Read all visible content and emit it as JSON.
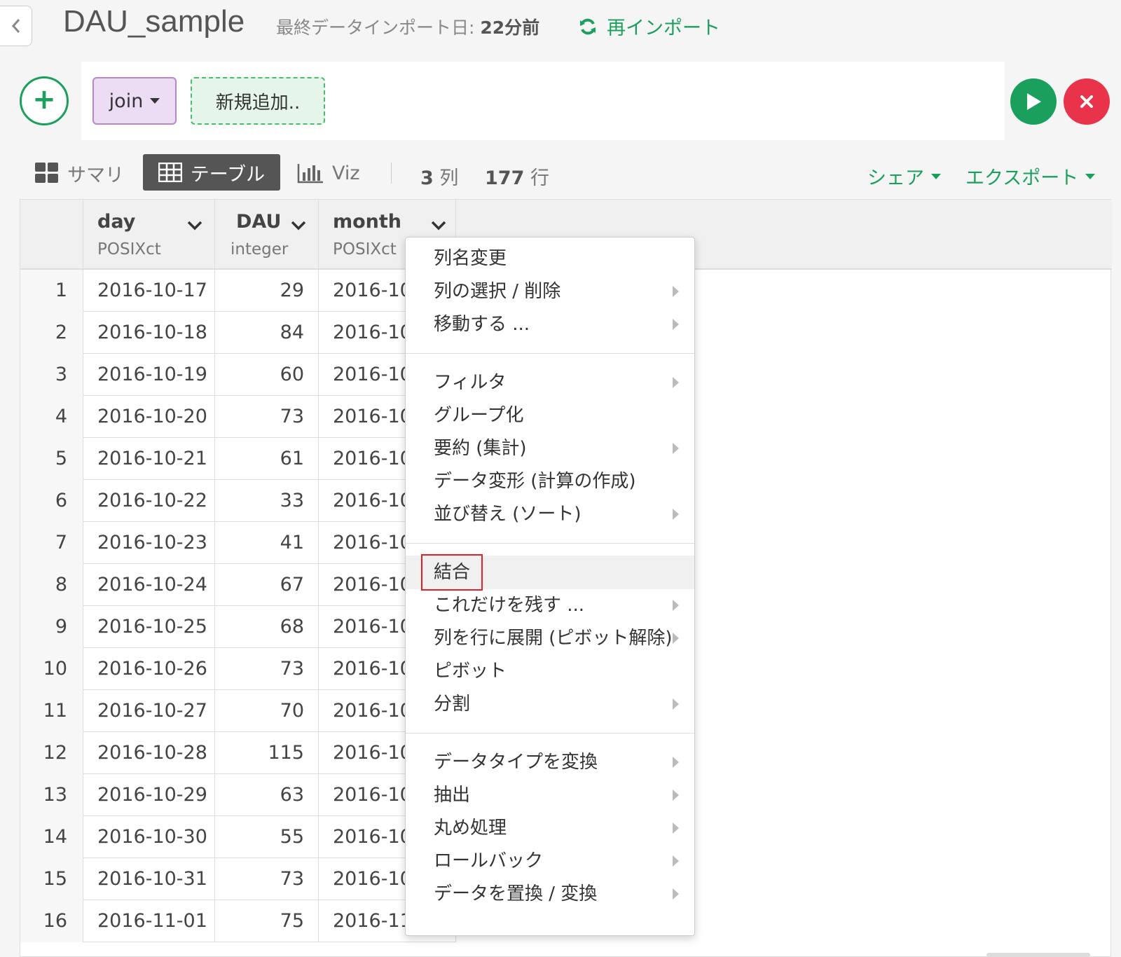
{
  "header": {
    "title": "DAU_sample",
    "last_import_label": "最終データインポート日: ",
    "last_import_value": "22分前",
    "reimport_label": "再インポート"
  },
  "pipeline": {
    "steps": [
      {
        "label": "join"
      }
    ],
    "new_step_label": "新規追加.."
  },
  "toolbar": {
    "tabs": [
      {
        "label": "サマリ",
        "icon": "grid-icon"
      },
      {
        "label": "テーブル",
        "icon": "table-icon",
        "active": true
      },
      {
        "label": "Viz",
        "icon": "bar-chart-icon"
      }
    ],
    "columns_count": "3",
    "columns_unit": " 列",
    "rows_count": "177",
    "rows_unit": " 行",
    "share_label": "シェア",
    "export_label": "エクスポート"
  },
  "table": {
    "columns": [
      {
        "name": "day",
        "type": "POSIXct"
      },
      {
        "name": "DAU",
        "type": "integer"
      },
      {
        "name": "month",
        "type": "POSIXct"
      }
    ],
    "rows": [
      {
        "num": "1",
        "day": "2016-10-17",
        "dau": "29",
        "month": "2016-10"
      },
      {
        "num": "2",
        "day": "2016-10-18",
        "dau": "84",
        "month": "2016-10"
      },
      {
        "num": "3",
        "day": "2016-10-19",
        "dau": "60",
        "month": "2016-10"
      },
      {
        "num": "4",
        "day": "2016-10-20",
        "dau": "73",
        "month": "2016-10"
      },
      {
        "num": "5",
        "day": "2016-10-21",
        "dau": "61",
        "month": "2016-10"
      },
      {
        "num": "6",
        "day": "2016-10-22",
        "dau": "33",
        "month": "2016-10"
      },
      {
        "num": "7",
        "day": "2016-10-23",
        "dau": "41",
        "month": "2016-10"
      },
      {
        "num": "8",
        "day": "2016-10-24",
        "dau": "67",
        "month": "2016-10"
      },
      {
        "num": "9",
        "day": "2016-10-25",
        "dau": "68",
        "month": "2016-10"
      },
      {
        "num": "10",
        "day": "2016-10-26",
        "dau": "73",
        "month": "2016-10"
      },
      {
        "num": "11",
        "day": "2016-10-27",
        "dau": "70",
        "month": "2016-10"
      },
      {
        "num": "12",
        "day": "2016-10-28",
        "dau": "115",
        "month": "2016-10"
      },
      {
        "num": "13",
        "day": "2016-10-29",
        "dau": "63",
        "month": "2016-10"
      },
      {
        "num": "14",
        "day": "2016-10-30",
        "dau": "55",
        "month": "2016-10"
      },
      {
        "num": "15",
        "day": "2016-10-31",
        "dau": "73",
        "month": "2016-10"
      },
      {
        "num": "16",
        "day": "2016-11-01",
        "dau": "75",
        "month": "2016-11"
      }
    ]
  },
  "context_menu": {
    "groups": [
      [
        {
          "label": "列名変更",
          "submenu": false
        },
        {
          "label": "列の選択 / 削除",
          "submenu": true
        },
        {
          "label": "移動する ...",
          "submenu": true
        }
      ],
      [
        {
          "label": "フィルタ",
          "submenu": true
        },
        {
          "label": "グループ化",
          "submenu": false
        },
        {
          "label": "要約 (集計)",
          "submenu": true
        },
        {
          "label": "データ変形 (計算の作成)",
          "submenu": false
        },
        {
          "label": "並び替え (ソート)",
          "submenu": true
        }
      ],
      [
        {
          "label": "結合",
          "submenu": false,
          "highlighted": true
        },
        {
          "label": "これだけを残す ...",
          "submenu": true
        },
        {
          "label": "列を行に展開 (ピボット解除)",
          "submenu": true
        },
        {
          "label": "ピボット",
          "submenu": false
        },
        {
          "label": "分割",
          "submenu": true
        }
      ],
      [
        {
          "label": "データタイプを変換",
          "submenu": true
        },
        {
          "label": "抽出",
          "submenu": true
        },
        {
          "label": "丸め処理",
          "submenu": true
        },
        {
          "label": "ロールバック",
          "submenu": true
        },
        {
          "label": "データを置換 / 変換",
          "submenu": true
        }
      ]
    ]
  },
  "colors": {
    "accent": "#1aa05c",
    "danger": "#e8334a",
    "join_step_bg": "#ecdcf4",
    "highlight_box": "#e0202a"
  }
}
